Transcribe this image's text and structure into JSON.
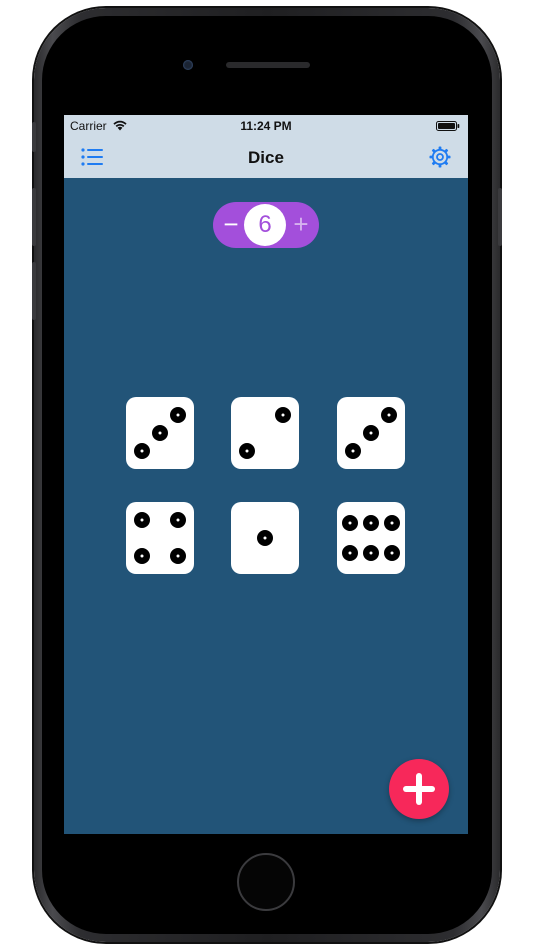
{
  "status_bar": {
    "carrier": "Carrier",
    "time": "11:24 PM"
  },
  "nav": {
    "title": "Dice",
    "list_icon": "list-icon",
    "settings_icon": "gear-icon"
  },
  "stepper": {
    "value": "6",
    "minus_label": "−",
    "plus_label": "+"
  },
  "dice": [
    {
      "face": 3
    },
    {
      "face": 2
    },
    {
      "face": 3
    },
    {
      "face": 4
    },
    {
      "face": 1
    },
    {
      "face": 6
    }
  ],
  "fab": {
    "icon": "plus-icon"
  },
  "colors": {
    "background": "#225478",
    "bar": "#cfdce7",
    "accent_blue": "#1f7cf2",
    "stepper": "#a34fdb",
    "fab": "#f7285a"
  }
}
